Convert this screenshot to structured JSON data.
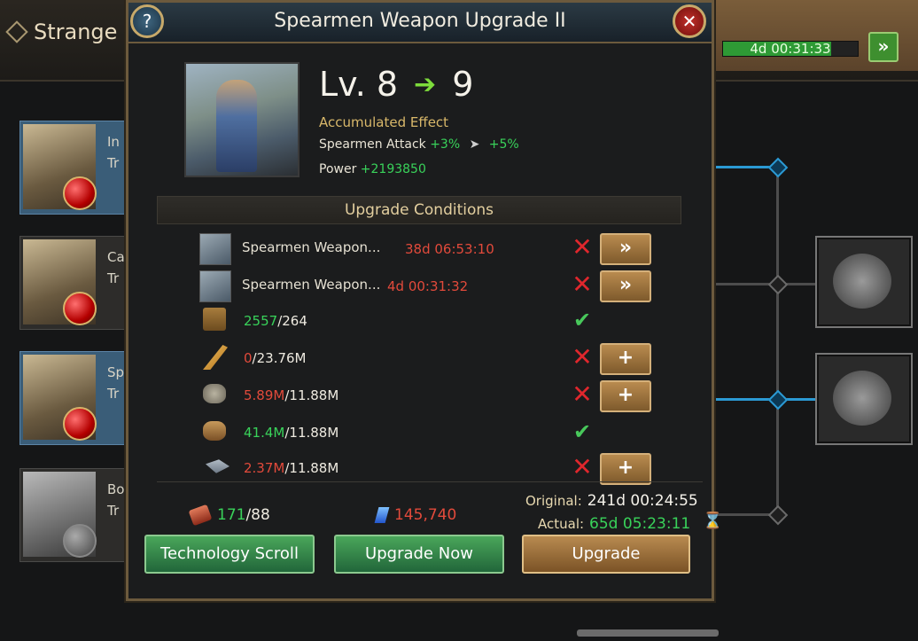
{
  "background": {
    "title": "Strange",
    "timer_text": "4d 00:31:33",
    "timer_progress": 0.8,
    "speedup_label": "»",
    "cards": [
      {
        "label_line1": "In",
        "label_line2": "Tr"
      },
      {
        "label_line1": "Ca",
        "label_line2": "Tr"
      },
      {
        "label_line1": "Sp",
        "label_line2": "Tr"
      },
      {
        "label_line1": "Bo",
        "label_line2": "Tr"
      }
    ]
  },
  "modal": {
    "title": "Spearmen Weapon Upgrade II",
    "help_label": "?",
    "close_label": "✕",
    "level_current": "Lv. 8",
    "level_next": "9",
    "arrow_glyph": "➔",
    "accumulated_effect_label": "Accumulated Effect",
    "effect_name": "Spearmen Attack",
    "effect_current": "+3%",
    "effect_next": "+5%",
    "power_label": "Power",
    "power_value": "+2193850",
    "conditions_header": "Upgrade Conditions",
    "conditions": [
      {
        "type": "tech",
        "name": "Spearmen Weapon...",
        "time": "38d 06:53:10",
        "met": false,
        "action": "»"
      },
      {
        "type": "tech",
        "name": "Spearmen Weapon...",
        "time": "4d 00:31:32",
        "met": false,
        "action": "»"
      },
      {
        "type": "book",
        "have": "2557",
        "need": "/264",
        "met": true
      },
      {
        "type": "feather",
        "have": "0",
        "need": "/23.76M",
        "met": false,
        "action": "+"
      },
      {
        "type": "stone",
        "have": "5.89M",
        "need": "/11.88M",
        "met": false,
        "action": "+"
      },
      {
        "type": "wood",
        "have": "41.4M",
        "need": "/11.88M",
        "met": true
      },
      {
        "type": "iron",
        "have": "2.37M",
        "need": "/11.88M",
        "met": false,
        "action": "+"
      }
    ],
    "scroll_have": "171",
    "scroll_need": "/88",
    "gem_amount": "145,740",
    "original_label": "Original:",
    "original_time": "241d 00:24:55",
    "actual_label": "Actual:",
    "actual_time": "65d 05:23:11",
    "buttons": {
      "technology_scroll": "Technology Scroll",
      "upgrade_now": "Upgrade Now",
      "upgrade": "Upgrade"
    }
  },
  "colors": {
    "met_green": "#39d25a",
    "unmet_red": "#e24a3b",
    "accent_gold": "#c7a96a"
  }
}
